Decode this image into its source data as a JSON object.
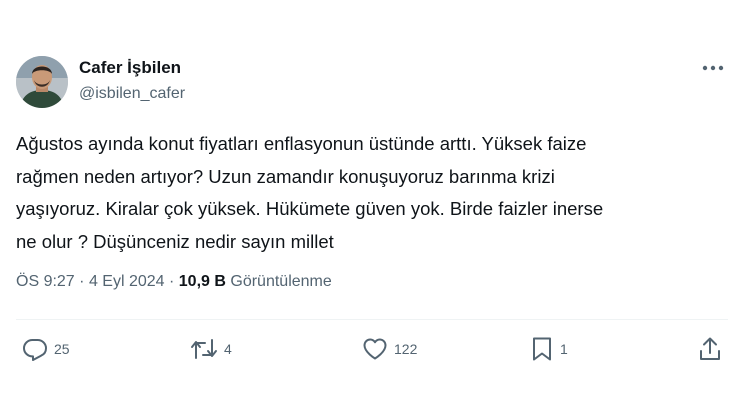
{
  "author": {
    "name": "Cafer İşbilen",
    "handle": "@isbilen_cafer"
  },
  "tweet": {
    "lines": [
      "Ağustos ayında konut fiyatları enflasyonun üstünde arttı. Yüksek faize",
      "rağmen neden artıyor? Uzun zamandır konuşuyoruz barınma krizi",
      "yaşıyoruz. Kiralar çok yüksek. Hükümete güven yok. Birde faizler inerse",
      "ne olur ? Düşünceniz nedir sayın millet"
    ]
  },
  "meta": {
    "time": "ÖS 9:27",
    "separator": "·",
    "date": "4 Eyl 2024",
    "views_count": "10,9 B",
    "views_label": "Görüntülenme"
  },
  "actions": {
    "replies": "25",
    "reposts": "4",
    "likes": "122",
    "bookmarks": "1"
  },
  "icons": {
    "more": "more-icon",
    "reply": "reply-icon",
    "repost": "repost-icon",
    "like": "like-icon",
    "bookmark": "bookmark-icon",
    "share": "share-icon"
  },
  "colors": {
    "text_primary": "#0f1419",
    "text_secondary": "#536471",
    "divider": "#eff3f4"
  }
}
